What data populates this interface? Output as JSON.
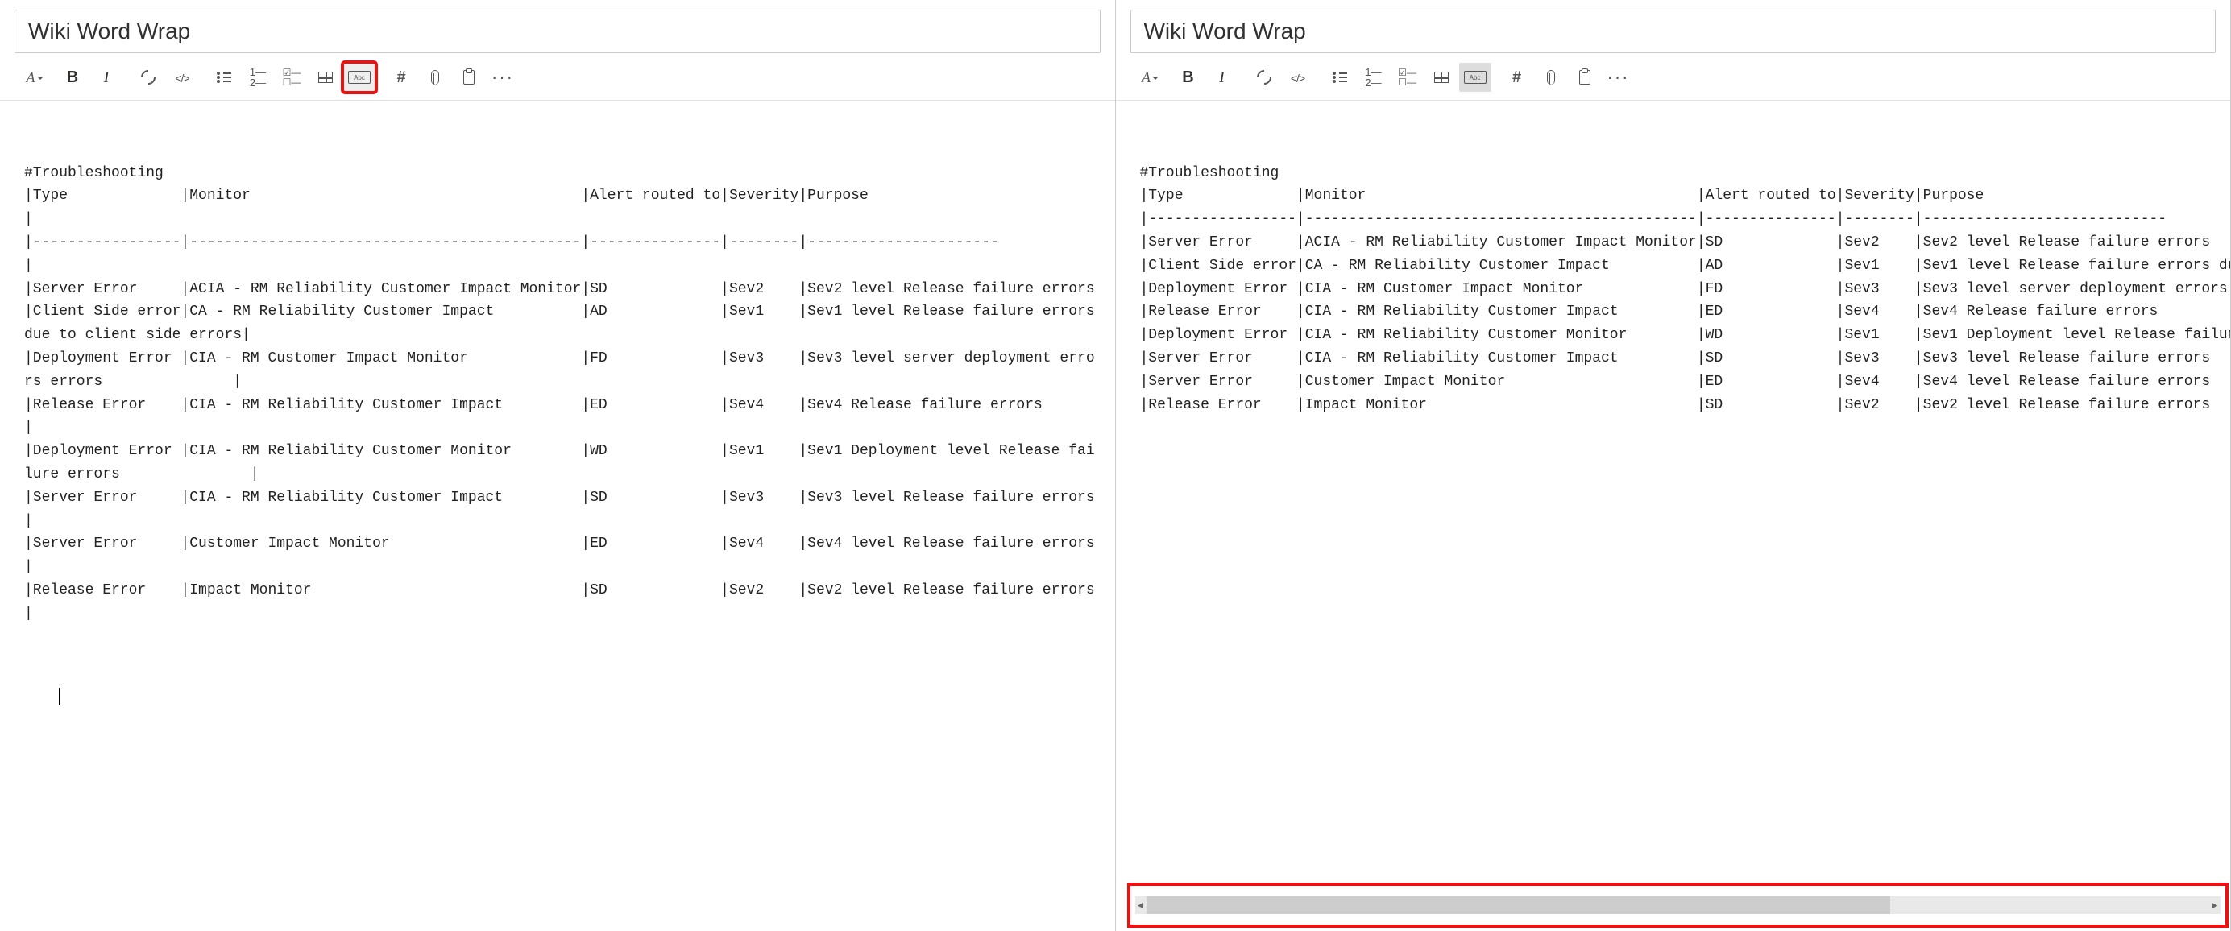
{
  "title": "Wiki Word Wrap",
  "toolbar": {
    "text_format": "Text format",
    "bold": "B",
    "italic": "I",
    "link": "Link",
    "code": "Code",
    "ul": "Bulleted list",
    "ol": "Numbered list",
    "checklist": "Checklist",
    "table": "Table",
    "wordwrap": "Abc",
    "hash": "#",
    "attach": "Attach",
    "paste": "Paste",
    "more": "More"
  },
  "left_content": "#Troubleshooting\n|Type             |Monitor                                      |Alert routed to|Severity|Purpose\n|\n|-----------------|---------------------------------------------|---------------|--------|----------------------\n|\n|Server Error     |ACIA - RM Reliability Customer Impact Monitor|SD             |Sev2    |Sev2 level Release failure errors\n|Client Side error|CA - RM Reliability Customer Impact          |AD             |Sev1    |Sev1 level Release failure errors due to client side errors|\n|Deployment Error |CIA - RM Customer Impact Monitor             |FD             |Sev3    |Sev3 level server deployment errors errors               |\n|Release Error    |CIA - RM Reliability Customer Impact         |ED             |Sev4    |Sev4 Release failure errors                                |\n|Deployment Error |CIA - RM Reliability Customer Monitor        |WD             |Sev1    |Sev1 Deployment level Release failure errors               |\n|Server Error     |CIA - RM Reliability Customer Impact         |SD             |Sev3    |Sev3 level Release failure errors                          |\n|Server Error     |Customer Impact Monitor                      |ED             |Sev4    |Sev4 level Release failure errors                          |\n|Release Error    |Impact Monitor                               |SD             |Sev2    |Sev2 level Release failure errors                          |\n\n",
  "right_content": "#Troubleshooting\n|Type             |Monitor                                      |Alert routed to|Severity|Purpose\n|-----------------|---------------------------------------------|---------------|--------|----------------------------\n|Server Error     |ACIA - RM Reliability Customer Impact Monitor|SD             |Sev2    |Sev2 level Release failure errors\n|Client Side error|CA - RM Reliability Customer Impact          |AD             |Sev1    |Sev1 level Release failure errors due to client side errors\n|Deployment Error |CIA - RM Customer Impact Monitor             |FD             |Sev3    |Sev3 level server deployment errors errors\n|Release Error    |CIA - RM Reliability Customer Impact         |ED             |Sev4    |Sev4 Release failure errors\n|Deployment Error |CIA - RM Reliability Customer Monitor        |WD             |Sev1    |Sev1 Deployment level Release failure errors\n|Server Error     |CIA - RM Reliability Customer Impact         |SD             |Sev3    |Sev3 level Release failure errors\n|Server Error     |Customer Impact Monitor                      |ED             |Sev4    |Sev4 level Release failure errors\n|Release Error    |Impact Monitor                               |SD             |Sev2    |Sev2 level Release failure errors\n"
}
